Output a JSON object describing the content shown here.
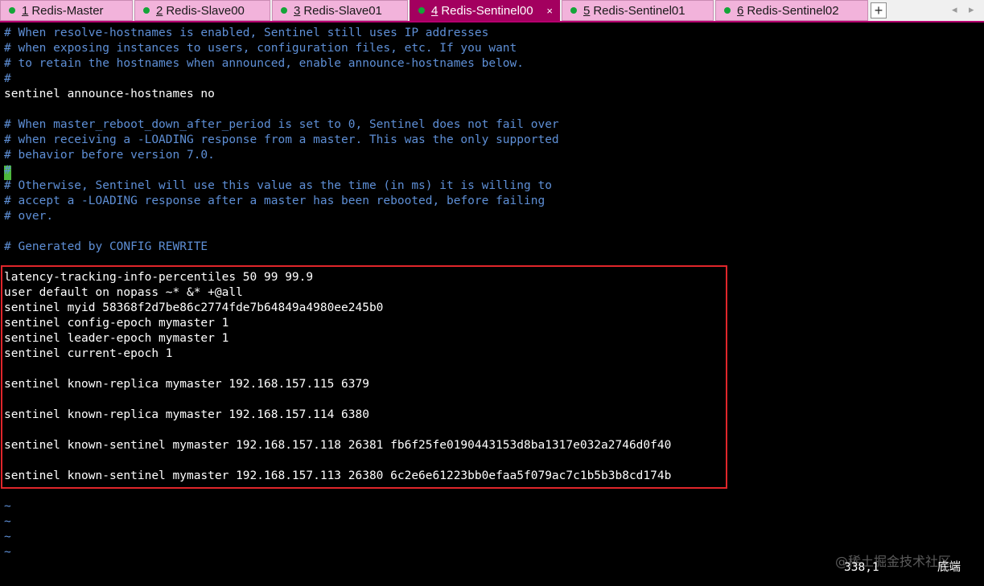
{
  "tabs": [
    {
      "number": "1",
      "label": "Redis-Master"
    },
    {
      "number": "2",
      "label": "Redis-Slave00"
    },
    {
      "number": "3",
      "label": "Redis-Slave01"
    },
    {
      "number": "4",
      "label": "Redis-Sentinel00"
    },
    {
      "number": "5",
      "label": "Redis-Sentinel01"
    },
    {
      "number": "6",
      "label": "Redis-Sentinel02"
    }
  ],
  "tab_close_glyph": "×",
  "tab_add_glyph": "+",
  "tab_nav": {
    "prev": "◂",
    "next": "▸"
  },
  "colors": {
    "active_tab": "#a3005f",
    "inactive_tab": "#f2b3db",
    "status_dot": "#13a538",
    "comment": "#5e8fd6",
    "highlight_border": "#e0262b",
    "cursor": "#4cb83c"
  },
  "lines": [
    "# When resolve-hostnames is enabled, Sentinel still uses IP addresses",
    "# when exposing instances to users, configuration files, etc. If you want",
    "# to retain the hostnames when announced, enable announce-hostnames below.",
    "#",
    "sentinel announce-hostnames no",
    "",
    "# When master_reboot_down_after_period is set to 0, Sentinel does not fail over",
    "# when receiving a -LOADING response from a master. This was the only supported",
    "# behavior before version 7.0.",
    "#",
    "# Otherwise, Sentinel will use this value as the time (in ms) it is willing to",
    "# accept a -LOADING response after a master has been rebooted, before failing",
    "# over.",
    "",
    "# Generated by CONFIG REWRITE",
    "",
    "latency-tracking-info-percentiles 50 99 99.9",
    "user default on nopass ~* &* +@all",
    "sentinel myid 58368f2d7be86c2774fde7b64849a4980ee245b0",
    "sentinel config-epoch mymaster 1",
    "sentinel leader-epoch mymaster 1",
    "sentinel current-epoch 1",
    "",
    "sentinel known-replica mymaster 192.168.157.115 6379",
    "",
    "sentinel known-replica mymaster 192.168.157.114 6380",
    "",
    "sentinel known-sentinel mymaster 192.168.157.118 26381 fb6f25fe0190443153d8ba1317e032a2746d0f40",
    "",
    "sentinel known-sentinel mymaster 192.168.157.113 26380 6c2e6e61223bb0efaa5f079ac7c1b5b3b8cd174b",
    "",
    "~",
    "~",
    "~",
    "~"
  ],
  "status": {
    "position": "338,1",
    "mode": "底端"
  },
  "watermark": "@稀土掘金技术社区"
}
